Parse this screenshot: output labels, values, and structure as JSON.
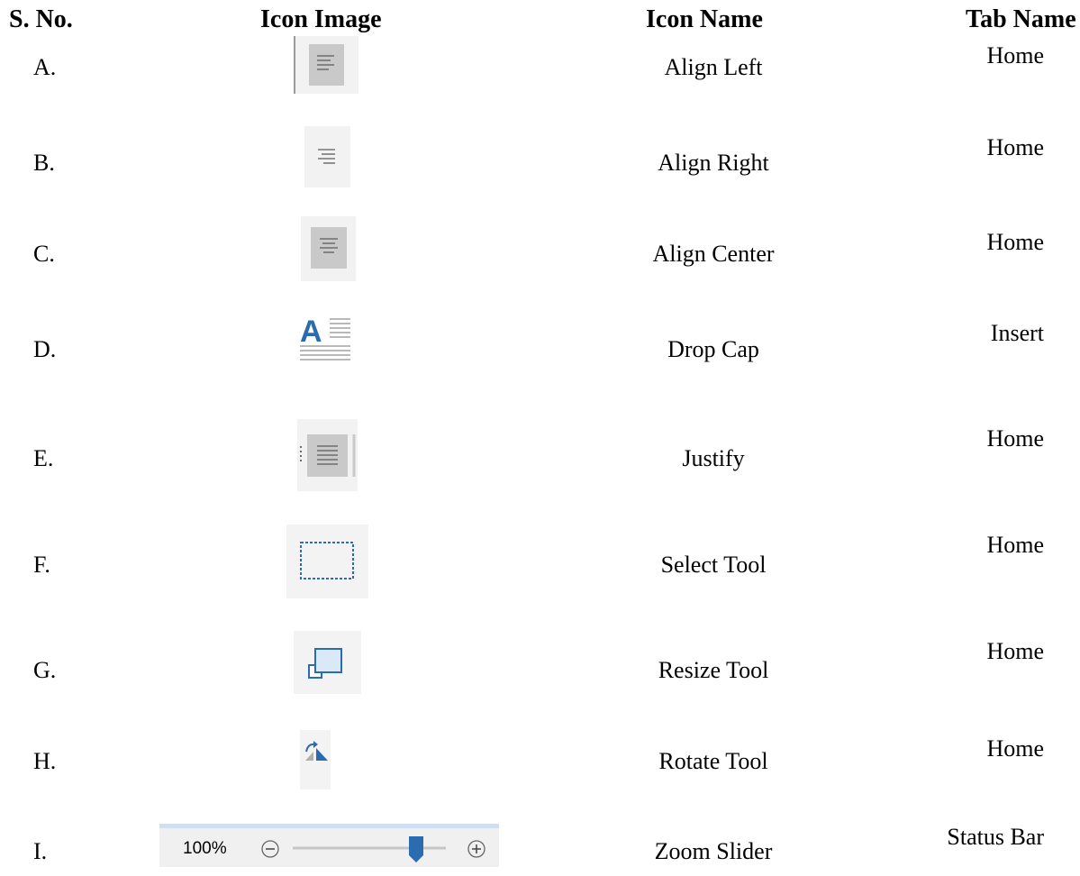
{
  "headers": {
    "sno": "S. No.",
    "icon_image": "Icon Image",
    "icon_name": "Icon Name",
    "tab_name": "Tab Name"
  },
  "rows": [
    {
      "sno": "A.",
      "icon": "align-left-icon",
      "name": "Align Left",
      "tab": "Home"
    },
    {
      "sno": "B.",
      "icon": "align-right-icon",
      "name": "Align Right",
      "tab": "Home"
    },
    {
      "sno": "C.",
      "icon": "align-center-icon",
      "name": "Align Center",
      "tab": "Home"
    },
    {
      "sno": "D.",
      "icon": "drop-cap-icon",
      "name": "Drop Cap",
      "tab": "Insert"
    },
    {
      "sno": "E.",
      "icon": "justify-icon",
      "name": "Justify",
      "tab": "Home"
    },
    {
      "sno": "F.",
      "icon": "select-tool-icon",
      "name": "Select Tool",
      "tab": "Home"
    },
    {
      "sno": "G.",
      "icon": "resize-tool-icon",
      "name": "Resize Tool",
      "tab": "Home"
    },
    {
      "sno": "H.",
      "icon": "rotate-tool-icon",
      "name": "Rotate Tool",
      "tab": "Home"
    },
    {
      "sno": "I.",
      "icon": "zoom-slider-icon",
      "name": "Zoom Slider",
      "tab": "Status Bar"
    }
  ],
  "zoom_slider": {
    "zoom_percent_label": "100%",
    "zoom_level": 1.0
  },
  "colors": {
    "icon_blue": "#2b6cb0",
    "icon_gray_bg": "#c8c8c8",
    "icon_light_bg": "#f0f0f0"
  }
}
